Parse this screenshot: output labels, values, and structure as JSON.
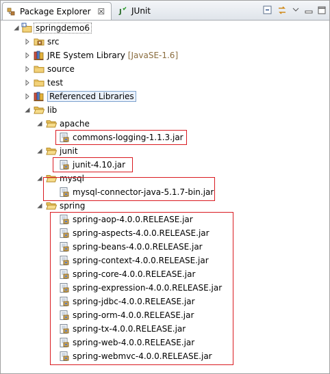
{
  "tabs": {
    "package_explorer": "Package Explorer",
    "close_glyph": "☒",
    "junit": "JUnit"
  },
  "tree": {
    "project": "springdemo6",
    "src": "src",
    "jre_label": "JRE System Library",
    "jre_decoration": "[JavaSE-1.6]",
    "source": "source",
    "test": "test",
    "referenced_libraries": "Referenced Libraries",
    "lib": "lib",
    "apache": "apache",
    "apache_jars": [
      "commons-logging-1.1.3.jar"
    ],
    "junit": "junit",
    "junit_jars": [
      "junit-4.10.jar"
    ],
    "mysql": "mysql",
    "mysql_jars": [
      "mysql-connector-java-5.1.7-bin.jar"
    ],
    "spring": "spring",
    "spring_jars": [
      "spring-aop-4.0.0.RELEASE.jar",
      "spring-aspects-4.0.0.RELEASE.jar",
      "spring-beans-4.0.0.RELEASE.jar",
      "spring-context-4.0.0.RELEASE.jar",
      "spring-core-4.0.0.RELEASE.jar",
      "spring-expression-4.0.0.RELEASE.jar",
      "spring-jdbc-4.0.0.RELEASE.jar",
      "spring-orm-4.0.0.RELEASE.jar",
      "spring-tx-4.0.0.RELEASE.jar",
      "spring-web-4.0.0.RELEASE.jar",
      "spring-webmvc-4.0.0.RELEASE.jar"
    ]
  },
  "colors": {
    "highlight_box": "#d9191f",
    "folder": "#e8c15a",
    "decoration": "#8a6c3e"
  }
}
